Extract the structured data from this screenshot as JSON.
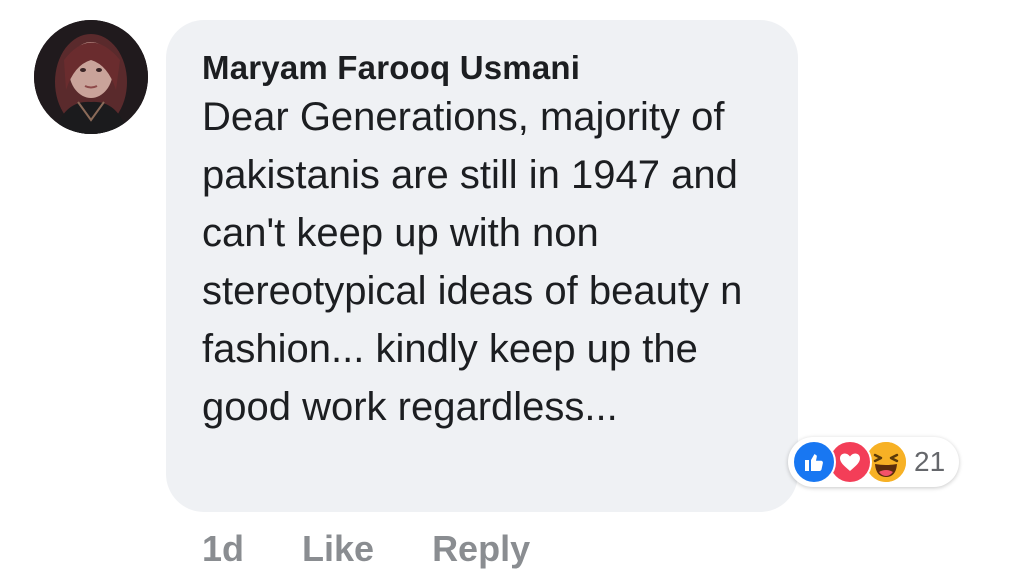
{
  "comment": {
    "author": "Maryam Farooq Usmani",
    "text": "Dear Generations, majority of pakistanis are still in 1947 and can't keep up with non stereotypical ideas of beauty n fashion... kindly keep up the good work regardless...",
    "timestamp": "1d",
    "like_label": "Like",
    "reply_label": "Reply",
    "reactions": {
      "icons": [
        "like-icon",
        "love-icon",
        "haha-icon"
      ],
      "count": "21"
    }
  },
  "colors": {
    "bubble": "#eff1f4",
    "text": "#1c1e21",
    "muted": "#8a8d91",
    "like": "#1877f2",
    "love": "#f33e58",
    "haha": "#f7b125"
  }
}
